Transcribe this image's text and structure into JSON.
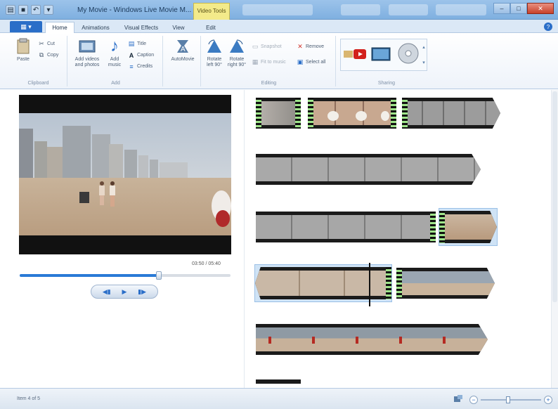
{
  "window": {
    "title": "My Movie - Windows Live Movie M...",
    "contextual_tab": "Video Tools"
  },
  "tabs": [
    {
      "label": "Home",
      "active": true
    },
    {
      "label": "Animations",
      "active": false
    },
    {
      "label": "Visual Effects",
      "active": false
    },
    {
      "label": "View",
      "active": false
    },
    {
      "label": "Edit",
      "active": false
    }
  ],
  "ribbon": {
    "clipboard": {
      "label": "Clipboard",
      "paste": "Paste",
      "cut": "Cut",
      "copy": "Copy"
    },
    "add": {
      "label": "Add",
      "add_videos": "Add videos and photos",
      "add_music": "Add music",
      "title": "Title",
      "caption": "Caption",
      "credits": "Credits"
    },
    "automovie": {
      "label": "AutoMovie"
    },
    "editing": {
      "label": "Editing",
      "rotate_left": "Rotate left 90°",
      "rotate_right": "Rotate right 90°",
      "snap": "Snapshot",
      "fit_music": "Fit to music",
      "remove": "Remove",
      "select_all": "Select all"
    },
    "sharing": {
      "label": "Sharing"
    }
  },
  "player": {
    "timestamp": "03:50 / 05:40",
    "progress": 0.66
  },
  "status": {
    "text": "Item 4 of 5",
    "zoom_level": 0.45
  },
  "colors": {
    "accent": "#2a6ec8",
    "ribbon_bg": "#eef3fa",
    "selection": "#cfe3f6",
    "contextual": "#f3ea8a"
  }
}
